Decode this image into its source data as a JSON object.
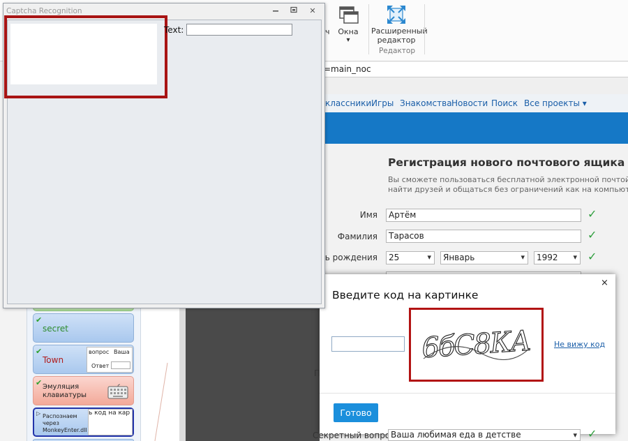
{
  "ribbon": {
    "partial_button_label": "ч",
    "windows_label": "Окна",
    "windows_arrow": "▾",
    "advanced_editor_label": "Расширенный\nредактор",
    "editor_group_label": "Редактор"
  },
  "address_bar": {
    "text": "=main_noc"
  },
  "site_nav": {
    "items": [
      "классники",
      "Игры",
      "Знакомства",
      "Новости",
      "Поиск",
      "Все проекты ▾"
    ]
  },
  "registration": {
    "title": "Регистрация нового почтового ящика",
    "subtitle_line1": "Вы сможете пользоваться бесплатной электронной почтой и другим",
    "subtitle_line2": "найти друзей и общаться без ограничений как на компьютере, так и",
    "first_name_label": "Имя",
    "first_name_value": "Артём",
    "last_name_label": "Фамилия",
    "last_name_value": "Тарасов",
    "birthday_label": "День рождения",
    "birthday_day": "25",
    "birthday_month": "Январь",
    "birthday_year": "1992",
    "partial_label_p": "П",
    "secret_question_label": "Секретный вопрос",
    "secret_question_value": "Ваша любимая еда в детстве",
    "check_mark": "✓"
  },
  "captcha_dialog": {
    "title": "Введите код на картинке",
    "close_symbol": "×",
    "cant_see_link": "Не вижу код",
    "submit_label": "Готово",
    "captcha_image_text": "6бС8КА"
  },
  "captcha_window": {
    "title": "Captcha Recognition",
    "minimize_symbol": "▭",
    "restore_symbol": "⧉",
    "close_symbol": "✕",
    "text_label": "Text:",
    "text_value": ""
  },
  "side_cards": {
    "secret_label": "secret",
    "town_label": "Town",
    "town_thumb_q": "вопрос",
    "town_thumb_v": "Ваша",
    "town_thumb_a": "Ответ",
    "keyboard_label": "Эмуляция клавиатуры",
    "monkey_label": "Распознаем через MonkeyEnter.dll",
    "monkey_thumb_text": "ь код на кар",
    "check_mark": "✔"
  }
}
